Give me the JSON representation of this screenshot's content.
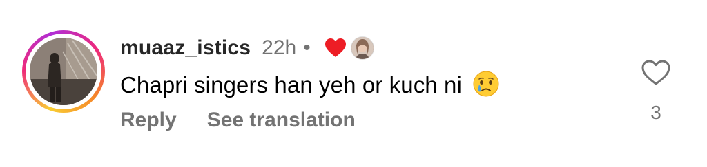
{
  "comment": {
    "username": "muaaz_istics",
    "timestamp": "22h",
    "separator": "•",
    "text": "Chapri singers han yeh or kuch ni",
    "emoji": "crying-face-emoji",
    "author_liked_icon": "red-heart-icon",
    "like_icon": "heart-outline-icon",
    "like_count": "3"
  },
  "actions": {
    "reply_label": "Reply",
    "translation_label": "See translation"
  },
  "colors": {
    "username": "#262626",
    "secondary_text": "#737373",
    "body_text": "#000000",
    "liked_heart": "#ed1d25",
    "story_ring_start": "#f9ce34",
    "story_ring_mid": "#ee2a7b",
    "story_ring_end": "#b02fd6"
  }
}
